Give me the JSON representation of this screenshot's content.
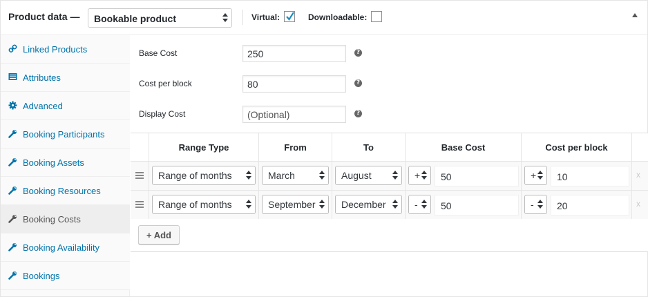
{
  "header": {
    "title": "Product data —",
    "product_type": "Bookable product",
    "virtual_label": "Virtual:",
    "virtual_checked": true,
    "downloadable_label": "Downloadable:",
    "downloadable_checked": false
  },
  "sidebar": {
    "items": [
      {
        "label": "Linked Products",
        "icon": "link-icon"
      },
      {
        "label": "Attributes",
        "icon": "list-icon"
      },
      {
        "label": "Advanced",
        "icon": "gear-icon"
      },
      {
        "label": "Booking Participants",
        "icon": "wrench-icon"
      },
      {
        "label": "Booking Assets",
        "icon": "wrench-icon"
      },
      {
        "label": "Booking Resources",
        "icon": "wrench-icon"
      },
      {
        "label": "Booking Costs",
        "icon": "wrench-icon",
        "active": true
      },
      {
        "label": "Booking Availability",
        "icon": "wrench-icon"
      },
      {
        "label": "Bookings",
        "icon": "wrench-icon"
      }
    ]
  },
  "fields": {
    "base_cost": {
      "label": "Base Cost",
      "value": "250"
    },
    "cost_per_block": {
      "label": "Cost per block",
      "value": "80"
    },
    "display_cost": {
      "label": "Display Cost",
      "placeholder": "(Optional)"
    }
  },
  "table": {
    "headers": [
      "Range Type",
      "From",
      "To",
      "Base Cost",
      "Cost per block"
    ],
    "rows": [
      {
        "range_type": "Range of months",
        "from": "March",
        "to": "August",
        "base_op": "+",
        "base_cost": "50",
        "block_op": "+",
        "block_cost": "10"
      },
      {
        "range_type": "Range of months",
        "from": "September",
        "to": "December",
        "base_op": "-",
        "base_cost": "50",
        "block_op": "-",
        "block_cost": "20"
      }
    ],
    "remove_symbol": "x",
    "add_label": "+ Add"
  },
  "colors": {
    "link": "#0073aa",
    "active_tab_bg": "#eeeeee",
    "check": "#1e8cbe"
  }
}
